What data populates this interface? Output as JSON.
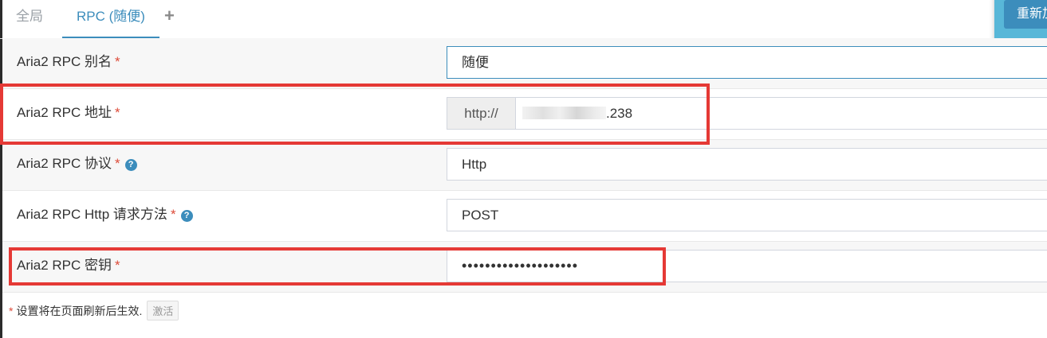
{
  "tabs": {
    "global_label": "全局",
    "rpc_label": "RPC (随便)",
    "add_label": "+"
  },
  "reload_button": "重新加载",
  "rows": {
    "alias": {
      "label": "Aria2 RPC 别名",
      "required": "*",
      "value": "随便"
    },
    "address": {
      "label": "Aria2 RPC 地址",
      "required": "*",
      "prefix": "http://",
      "value_suffix": ".238"
    },
    "protocol": {
      "label": "Aria2 RPC 协议",
      "required": "*",
      "help": "?",
      "value": "Http"
    },
    "method": {
      "label": "Aria2 RPC Http 请求方法",
      "required": "*",
      "help": "?",
      "value": "POST"
    },
    "secret": {
      "label": "Aria2 RPC 密钥",
      "required": "*",
      "value": "••••••••••••••••••••"
    }
  },
  "footer": {
    "required_mark": "*",
    "note": "设置将在页面刷新后生效.",
    "activate_label": "激活"
  },
  "colors": {
    "accent": "#3c8dbc",
    "required": "#dd4b39",
    "annotation": "#e53935"
  }
}
